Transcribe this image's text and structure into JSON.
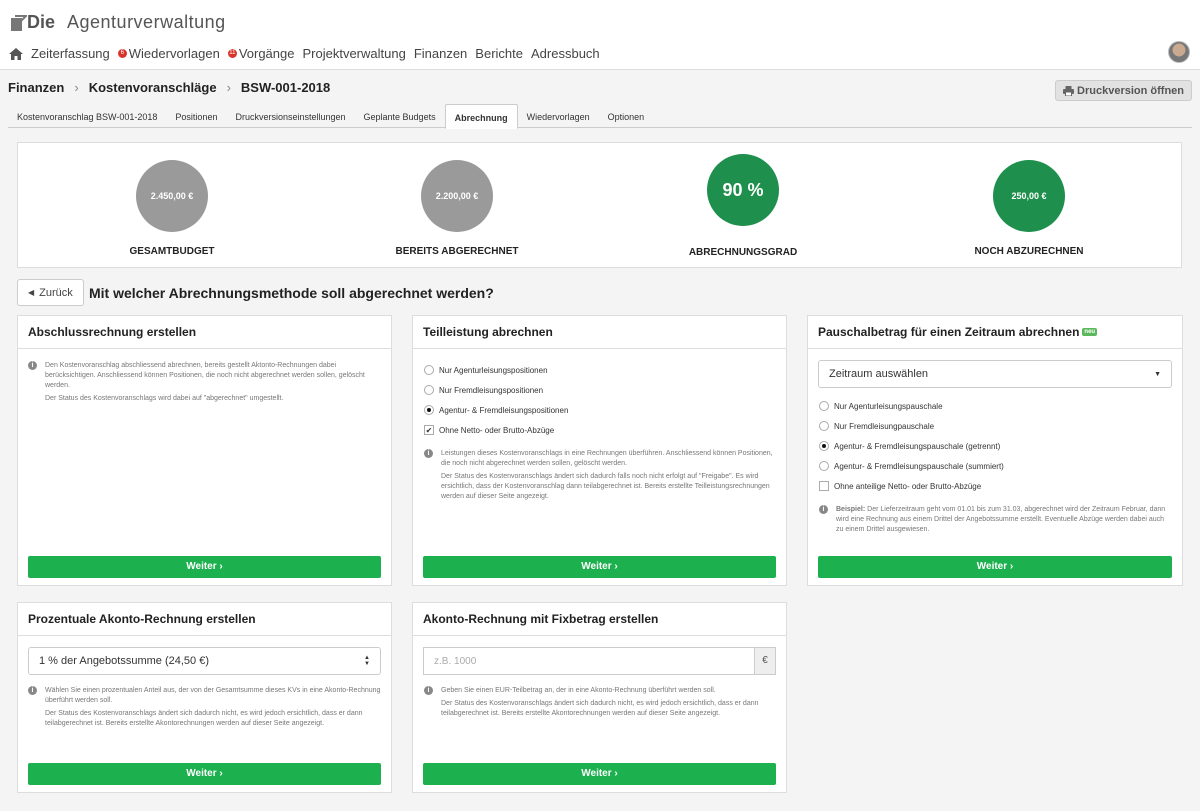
{
  "app": {
    "logo_bold": "Die",
    "logo_rest": "Agenturverwaltung"
  },
  "nav": {
    "items": [
      {
        "label": "Zeiterfassung"
      },
      {
        "label": "Wiedervorlagen",
        "badge": "6"
      },
      {
        "label": "Vorgänge",
        "badge": "11"
      },
      {
        "label": "Projektverwaltung"
      },
      {
        "label": "Finanzen"
      },
      {
        "label": "Berichte"
      },
      {
        "label": "Adressbuch"
      }
    ]
  },
  "breadcrumb": [
    "Finanzen",
    "Kostenvoranschläge",
    "BSW-001-2018"
  ],
  "print_button": "Druckversion öffnen",
  "tabs": [
    "Kostenvoranschlag BSW-001-2018",
    "Positionen",
    "Druckversionseinstellungen",
    "Geplante Budgets",
    "Abrechnung",
    "Wiedervorlagen",
    "Optionen"
  ],
  "active_tab": "Abrechnung",
  "stats": [
    {
      "value": "2.450,00 €",
      "label": "GESAMTBUDGET",
      "color": "#9a9a9a"
    },
    {
      "value": "2.200,00 €",
      "label": "BEREITS ABGERECHNET",
      "color": "#9a9a9a"
    },
    {
      "value": "90 %",
      "label": "ABRECHNUNGSGRAD",
      "color": "#1e8f4c"
    },
    {
      "value": "250,00 €",
      "label": "NOCH ABZURECHNEN",
      "color": "#1e8f4c"
    }
  ],
  "back_label": "Zurück",
  "question": "Mit welcher Abrechnungsmethode soll abgerechnet werden?",
  "weiter": "Weiter",
  "cards": {
    "abschluss": {
      "title": "Abschlussrechnung erstellen",
      "info": [
        "Den Kostenvoranschlag abschliessend abrechnen, bereits gestellt Aktonto-Rechnungen dabei berücksichtigen. Anschliessend können Positionen, die noch nicht abgerechnet werden sollen, gelöscht werden.",
        "Der Status des Kostenvoranschlags wird dabei auf \"abgerechnet\" umgestellt."
      ]
    },
    "teil": {
      "title": "Teilleistung abrechnen",
      "options": [
        "Nur Agenturleisungspositionen",
        "Nur Fremdleisungspositionen",
        "Agentur- & Fremdleisungspositionen"
      ],
      "checkbox": "Ohne Netto- oder Brutto-Abzüge",
      "info": [
        "Leistungen dieses Kostenvoranschlags in eine Rechnungen überführen. Anschliessend können Positionen, die noch nicht abgerechnet werden sollen, gelöscht werden.",
        "Der Status des Kostenvoranschlags ändert sich dadurch falls noch nicht erfolgt auf \"Freigabe\". Es wird ersichtlich, dass der Kostenvoranschlag dann teilabgerechnet ist. Bereits erstellte Teilleistungsrechnungen werden auf dieser Seite angezeigt."
      ]
    },
    "pauschal": {
      "title": "Pauschalbetrag für einen Zeitraum abrechnen",
      "badge": "neu",
      "select": "Zeitraum auswählen",
      "options": [
        "Nur Agenturleisungspauschale",
        "Nur Fremdleisungpauschale",
        "Agentur- & Fremdleisungspauschale (getrennt)",
        "Agentur- & Fremdleisungspauschale (summiert)"
      ],
      "checkbox": "Ohne anteilige Netto- oder Brutto-Abzüge",
      "info_bold": "Beispiel:",
      "info": "Der Lieferzeitraum geht vom 01.01 bis zum 31.03, abgerechnet wird der Zeitraum Februar, dann wird eine Rechnung aus einem Drittel der Angebotssumme erstellt. Eventuelle Abzüge werden dabei auch zu einem Drittel ausgewiesen."
    },
    "prozent": {
      "title": "Prozentuale Akonto-Rechnung erstellen",
      "select": "1 % der Angebotssumme (24,50 €)",
      "info": [
        "Wählen Sie einen prozentualen Anteil aus, der von der Gesamtsumme dieses KVs in eine Akonto-Rechnung überführt werden soll.",
        "Der Status des Kostenvoranschlags ändert sich dadurch nicht, es wird jedoch ersichtlich, dass er dann teilabgerechnet ist. Bereits erstellte Akontorechnungen werden auf dieser Seite angezeigt."
      ]
    },
    "fix": {
      "title": "Akonto-Rechnung mit Fixbetrag erstellen",
      "placeholder": "z.B. 1000",
      "currency": "€",
      "info": [
        "Geben Sie einen EUR-Teilbetrag an, der in eine Akonto-Rechnung überführt werden soll.",
        "Der Status des Kostenvoranschlags ändert sich dadurch nicht, es wird jedoch ersichtlich, dass er dann teilabgerechnet ist. Bereits erstellte Akontorechnungen werden auf dieser Seite angezeigt."
      ]
    }
  }
}
